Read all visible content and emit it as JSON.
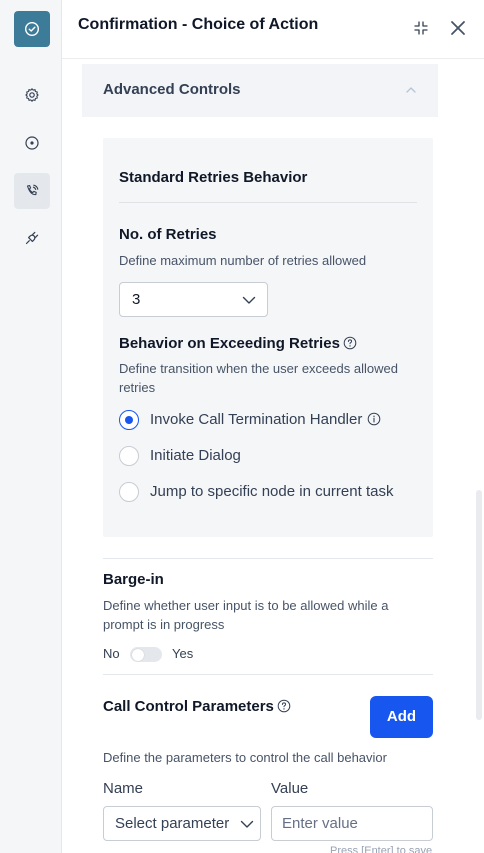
{
  "header": {
    "title": "Confirmation - Choice of Action"
  },
  "rail": {
    "items": [
      {
        "icon": "check-circle-icon",
        "active": true
      },
      {
        "icon": "gear-icon",
        "active": false
      },
      {
        "icon": "target-icon",
        "active": false
      },
      {
        "icon": "phone-call-icon",
        "active": true
      },
      {
        "icon": "plug-icon",
        "active": false
      }
    ]
  },
  "advanced": {
    "title": "Advanced Controls",
    "expanded": true
  },
  "retries": {
    "section_title": "Standard Retries Behavior",
    "count_label": "No. of Retries",
    "count_desc": "Define maximum number of retries allowed",
    "count_value": "3",
    "behavior_label": "Behavior on Exceeding Retries",
    "behavior_desc": "Define transition when the user exceeds allowed retries",
    "options": [
      {
        "label": "Invoke Call Termination Handler",
        "selected": true
      },
      {
        "label": "Initiate Dialog",
        "selected": false
      },
      {
        "label": "Jump to specific node in current task",
        "selected": false
      }
    ]
  },
  "barge_in": {
    "label": "Barge-in",
    "desc": "Define whether user input is to be allowed while a prompt is in progress",
    "off_label": "No",
    "on_label": "Yes",
    "enabled": false
  },
  "call_control": {
    "label": "Call Control Parameters",
    "add_label": "Add",
    "desc": "Define the parameters to control the call behavior",
    "name_label": "Name",
    "value_label": "Value",
    "name_select": "Select parameter",
    "value_placeholder": "Enter value",
    "hint": "Press [Enter] to save"
  },
  "colors": {
    "accent": "#1757f0",
    "brand": "#3d7c98"
  }
}
